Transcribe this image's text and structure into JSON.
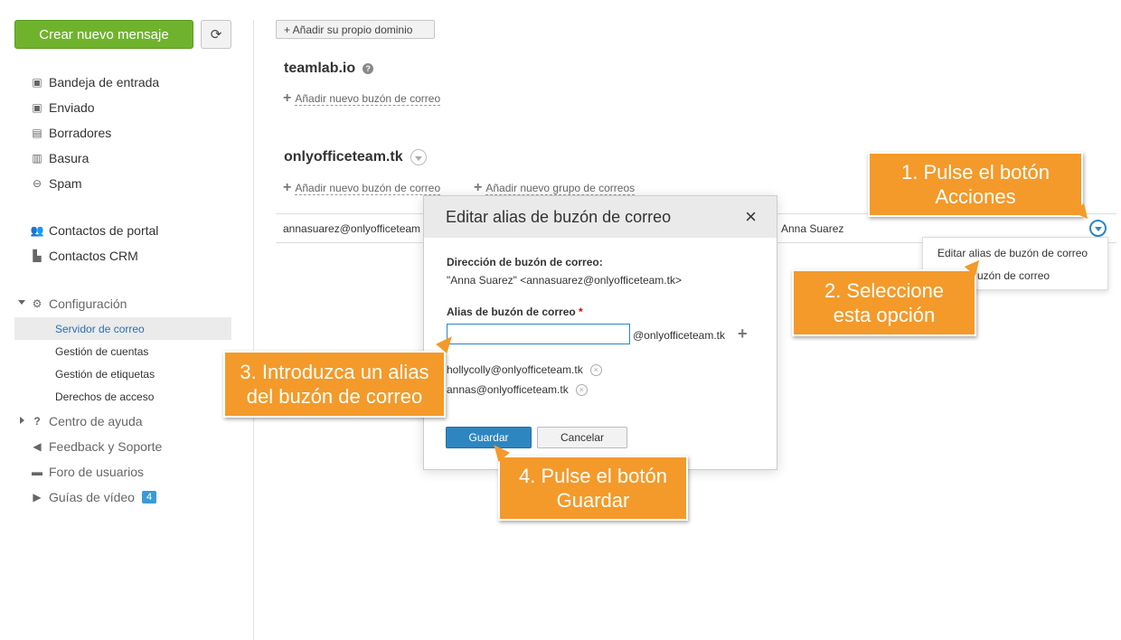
{
  "sidebar": {
    "new_message": "Crear nuevo mensaje",
    "refresh_icon": "refresh-icon",
    "folders": [
      {
        "label": "Bandeja de entrada",
        "icon": "inbox-icon"
      },
      {
        "label": "Enviado",
        "icon": "sent-icon"
      },
      {
        "label": "Borradores",
        "icon": "drafts-icon"
      },
      {
        "label": "Basura",
        "icon": "trash-icon"
      },
      {
        "label": "Spam",
        "icon": "spam-icon"
      }
    ],
    "contacts": [
      {
        "label": "Contactos de portal",
        "icon": "portal-contacts-icon"
      },
      {
        "label": "Contactos CRM",
        "icon": "crm-contacts-icon"
      }
    ],
    "settings": {
      "label": "Configuración",
      "items": [
        "Servidor de correo",
        "Gestión de cuentas",
        "Gestión de etiquetas",
        "Derechos de acceso"
      ]
    },
    "help": {
      "label": "Centro de ayuda"
    },
    "feedback": {
      "label": "Feedback y Soporte"
    },
    "forum": {
      "label": "Foro de usuarios"
    },
    "videos": {
      "label": "Guías de vídeo",
      "badge": "4"
    }
  },
  "main": {
    "add_domain": "+ Añadir su propio dominio",
    "domain1": {
      "name": "teamlab.io",
      "add_mailbox": "Añadir nuevo buzón de correo"
    },
    "domain2": {
      "name": "onlyofficeteam.tk",
      "add_mailbox": "Añadir nuevo buzón de correo",
      "add_group": "Añadir nuevo grupo de correos",
      "row": {
        "email": "annasuarez@onlyofficeteam",
        "name": "Anna Suarez"
      }
    }
  },
  "dropdown": {
    "item1": "Editar alias de buzón de correo",
    "item2": "uzón de correo"
  },
  "dialog": {
    "title": "Editar alias de buzón de correo",
    "close": "×",
    "address_label": "Dirección de buzón de correo:",
    "address_value": "\"Anna Suarez\" <annasuarez@onlyofficeteam.tk>",
    "alias_label": "Alias de buzón de correo",
    "required_mark": "*",
    "alias_value": "",
    "alias_suffix": "@onlyofficeteam.tk",
    "aliases": [
      "hollycolly@onlyofficeteam.tk",
      "annas@onlyofficeteam.tk"
    ],
    "save": "Guardar",
    "cancel": "Cancelar"
  },
  "callouts": {
    "c1": "1. Pulse el botón\nAcciones",
    "c2": "2. Seleccione\nesta opción",
    "c3": "3. Introduzca un alias\ndel buzón de correo",
    "c4": "4. Pulse el botón\nGuardar"
  },
  "colors": {
    "accent_green": "#6fb32d",
    "accent_blue": "#2e86c1",
    "callout_orange": "#f39a2a"
  }
}
